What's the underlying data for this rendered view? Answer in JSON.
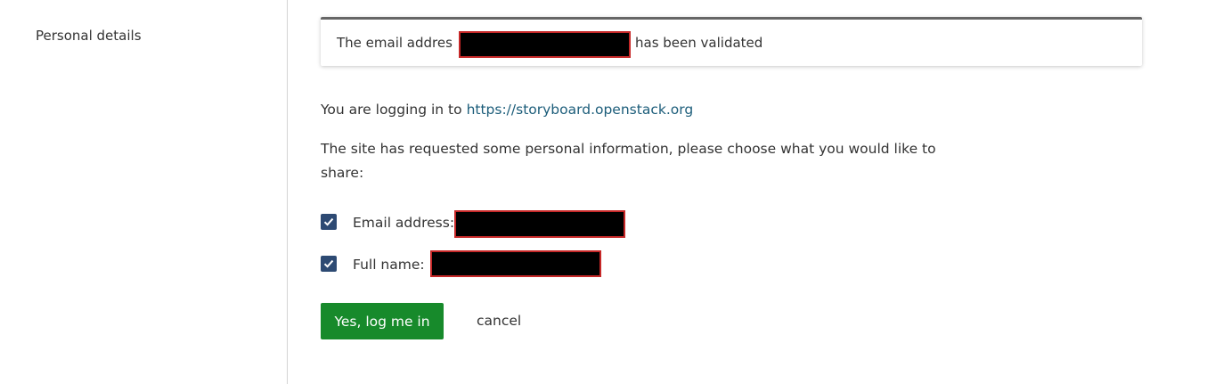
{
  "sidebar": {
    "title": "Personal details"
  },
  "alert": {
    "prefix": "The email addres",
    "suffix": "has been validated"
  },
  "login": {
    "intro": "You are logging in to",
    "url": "https://storyboard.openstack.org",
    "request_line1": "The site has requested some personal information, please choose what you would like to",
    "request_line2": "share:"
  },
  "fields": [
    {
      "label": "Email address:",
      "checked": true
    },
    {
      "label": "Full name:",
      "checked": true
    }
  ],
  "actions": {
    "confirm_label": "Yes, log me in",
    "cancel_label": "cancel"
  },
  "colors": {
    "checkbox": "#2d4a73",
    "primary_button": "#178a2b",
    "link": "#1c5d7a",
    "redaction_border": "#c62828"
  }
}
